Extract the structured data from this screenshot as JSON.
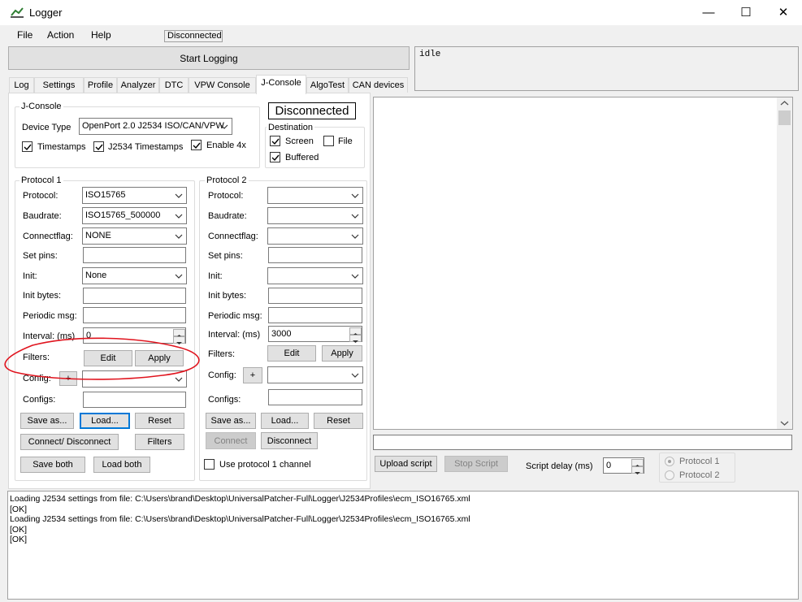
{
  "window": {
    "title": "Logger",
    "minimize_glyph": "—",
    "maximize_glyph": "☐",
    "close_glyph": "✕"
  },
  "menu": {
    "file": "File",
    "action": "Action",
    "help": "Help",
    "status": "Disconnected"
  },
  "toolbar": {
    "start_logging": "Start Logging",
    "idle_text": "idle"
  },
  "tabs": [
    "Log",
    "Settings",
    "Profile",
    "Analyzer",
    "DTC",
    "VPW Console",
    "J-Console",
    "AlgoTest",
    "CAN devices"
  ],
  "jconsole": {
    "group_title": "J-Console",
    "device_type_label": "Device Type",
    "device_type_value": "OpenPort 2.0 J2534 ISO/CAN/VPW",
    "timestamps": "Timestamps",
    "j2534_timestamps": "J2534 Timestamps",
    "enable_4x": "Enable 4x",
    "connection_status": "Disconnected",
    "destination_title": "Destination",
    "screen": "Screen",
    "file": "File",
    "buffered": "Buffered"
  },
  "protocol1": {
    "title": "Protocol 1",
    "protocol_label": "Protocol:",
    "protocol_value": "ISO15765",
    "baudrate_label": "Baudrate:",
    "baudrate_value": "ISO15765_500000",
    "connectflag_label": "Connectflag:",
    "connectflag_value": "NONE",
    "setpins_label": "Set pins:",
    "init_label": "Init:",
    "init_value": "None",
    "initbytes_label": "Init bytes:",
    "periodic_label": "Periodic msg:",
    "interval_label": "Interval: (ms)",
    "interval_value": "0",
    "filters_label": "Filters:",
    "edit": "Edit",
    "apply": "Apply",
    "config_label": "Config:",
    "plus": "+",
    "configs_label": "Configs:",
    "save_as": "Save as...",
    "load": "Load...",
    "reset": "Reset",
    "connect_disconnect": "Connect/ Disconnect",
    "filters_btn": "Filters",
    "save_both": "Save both",
    "load_both": "Load both"
  },
  "protocol2": {
    "title": "Protocol 2",
    "protocol_label": "Protocol:",
    "baudrate_label": "Baudrate:",
    "connectflag_label": "Connectflag:",
    "setpins_label": "Set pins:",
    "init_label": "Init:",
    "initbytes_label": "Init bytes:",
    "periodic_label": "Periodic msg:",
    "interval_label": "Interval: (ms)",
    "interval_value": "3000",
    "filters_label": "Filters:",
    "edit": "Edit",
    "apply": "Apply",
    "config_label": "Config:",
    "plus": "+",
    "configs_label": "Configs:",
    "save_as": "Save as...",
    "load": "Load...",
    "reset": "Reset",
    "connect": "Connect",
    "disconnect": "Disconnect",
    "use_protocol1": "Use protocol 1 channel"
  },
  "script": {
    "upload": "Upload script",
    "stop": "Stop Script",
    "delay_label": "Script delay (ms)",
    "delay_value": "0",
    "protocol1": "Protocol 1",
    "protocol2": "Protocol 2"
  },
  "log_lines": [
    "Loading J2534 settings from file: C:\\Users\\brand\\Desktop\\UniversalPatcher-Full\\Logger\\J2534Profiles\\ecm_ISO16765.xml",
    "[OK]",
    "Loading J2534 settings from file: C:\\Users\\brand\\Desktop\\UniversalPatcher-Full\\Logger\\J2534Profiles\\ecm_ISO16765.xml",
    "[OK]",
    "[OK]"
  ],
  "colors": {
    "annotation": "#e0141e",
    "focus": "#0078d7"
  }
}
